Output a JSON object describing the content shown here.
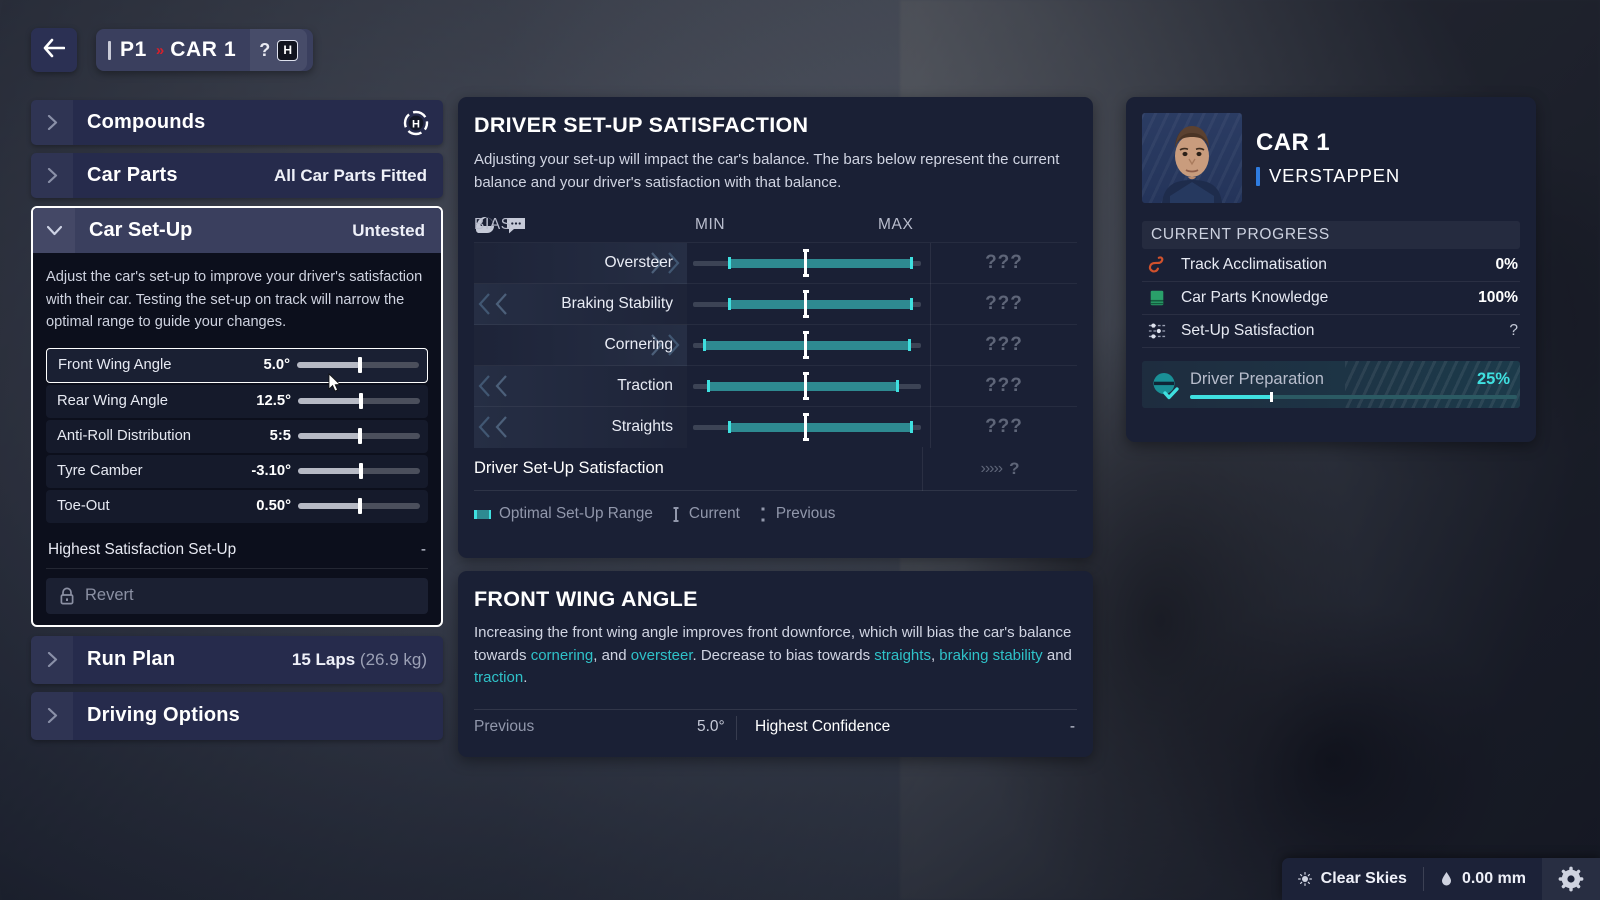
{
  "header": {
    "back_icon": "back-arrow-icon",
    "position": "P1",
    "separator": "»",
    "car_name": "CAR 1",
    "help_mark": "?",
    "compound_badge": "H"
  },
  "sidebar": {
    "items": [
      {
        "label": "Compounds",
        "value": "",
        "icon": "tyre-compound-hard-icon",
        "expanded": false
      },
      {
        "label": "Car Parts",
        "value": "All Car Parts Fitted",
        "expanded": false
      },
      {
        "label": "Run Plan",
        "value": "15 Laps",
        "value_sub": "(26.9 kg)",
        "expanded": false
      },
      {
        "label": "Driving Options",
        "value": "",
        "expanded": false
      }
    ],
    "setup": {
      "label": "Car Set-Up",
      "status": "Untested",
      "description": "Adjust the car's set-up to improve your driver's satisfaction with their car. Testing the set-up on track will narrow the optimal range to guide your changes.",
      "sliders": [
        {
          "name": "Front Wing Angle",
          "value": "5.0°",
          "pos_pct": 52,
          "selected": true
        },
        {
          "name": "Rear Wing Angle",
          "value": "12.5°",
          "pos_pct": 52,
          "selected": false
        },
        {
          "name": "Anti-Roll Distribution",
          "value": "5:5",
          "pos_pct": 51,
          "selected": false
        },
        {
          "name": "Tyre Camber",
          "value": "-3.10°",
          "pos_pct": 52,
          "selected": false
        },
        {
          "name": "Toe-Out",
          "value": "0.50°",
          "pos_pct": 51,
          "selected": false
        }
      ],
      "highest_satisfaction_label": "Highest Satisfaction Set-Up",
      "highest_satisfaction_value": "-",
      "revert_label": "Revert",
      "revert_icon": "lock-icon"
    }
  },
  "satisfaction": {
    "title": "DRIVER SET-UP SATISFACTION",
    "description": "Adjusting your set-up will impact the car's balance. The bars below represent the current balance and your driver's satisfaction with that balance.",
    "columns": {
      "bias": "BIAS",
      "min": "MIN",
      "max": "MAX"
    },
    "header_icons": [
      "helmet-icon",
      "speech-bubble-icon"
    ],
    "total_label": "Driver Set-Up Satisfaction",
    "total_arrows": "›››››",
    "total_value": "?",
    "legend": {
      "optimal": "Optimal Set-Up Range",
      "current": "Current",
      "previous": "Previous"
    },
    "colors": {
      "range": "#2e8a91",
      "range_edge": "#3fe0e0",
      "track": "#3c4355"
    },
    "chart_data": {
      "type": "bar",
      "title": "Driver Set-Up Satisfaction",
      "xlabel": "",
      "ylabel": "",
      "xlim": [
        0,
        100
      ],
      "categories": [
        "Oversteer",
        "Braking Stability",
        "Cornering",
        "Traction",
        "Straights"
      ],
      "series": [
        {
          "name": "Optimal Set-Up Range start",
          "values": [
            15.5,
            15.5,
            4.5,
            6.0,
            15.5
          ]
        },
        {
          "name": "Optimal Set-Up Range end",
          "values": [
            96.5,
            96.5,
            95.5,
            90.5,
            96.5
          ]
        },
        {
          "name": "Current",
          "values": [
            49.5,
            49.5,
            49.5,
            49.5,
            49.5
          ]
        }
      ],
      "scores": [
        "???",
        "???",
        "???",
        "???",
        "???"
      ],
      "directions": [
        "right",
        "left",
        "right",
        "left",
        "left"
      ]
    }
  },
  "front_wing": {
    "title": "FRONT WING ANGLE",
    "desc_part1": "Increasing the front wing angle improves front downforce, which will bias the car's balance towards ",
    "hl1": "cornering",
    "desc_part2": ", and ",
    "hl2": "oversteer",
    "desc_part3": ". Decrease to bias towards ",
    "hl3": "straights",
    "desc_part4": ", ",
    "hl4": "braking stability",
    "desc_part5": " and ",
    "hl5": "traction",
    "desc_part6": ".",
    "previous_label": "Previous",
    "previous_value": "5.0°",
    "confidence_label": "Highest Confidence",
    "confidence_value": "-"
  },
  "driver": {
    "car_label": "CAR 1",
    "surname": "VERSTAPPEN",
    "progress_title": "CURRENT PROGRESS",
    "progress": [
      {
        "label": "Track Acclimatisation",
        "value": "0%",
        "icon": "track-map-icon",
        "color": "#d0512c"
      },
      {
        "label": "Car Parts Knowledge",
        "value": "100%",
        "icon": "book-icon",
        "color": "#2aa06a"
      },
      {
        "label": "Set-Up Satisfaction",
        "value": "?",
        "icon": "sliders-icon",
        "color": "#c3c8d6"
      }
    ],
    "preparation": {
      "label": "Driver Preparation",
      "value": "25%",
      "pct": 25,
      "icon": "helmet-check-icon",
      "color": "#3fe0e0"
    }
  },
  "weather": {
    "condition": "Clear Skies",
    "condition_icon": "sun-icon",
    "rainfall": "0.00 mm",
    "rainfall_icon": "raindrop-icon",
    "settings_icon": "gear-icon"
  }
}
